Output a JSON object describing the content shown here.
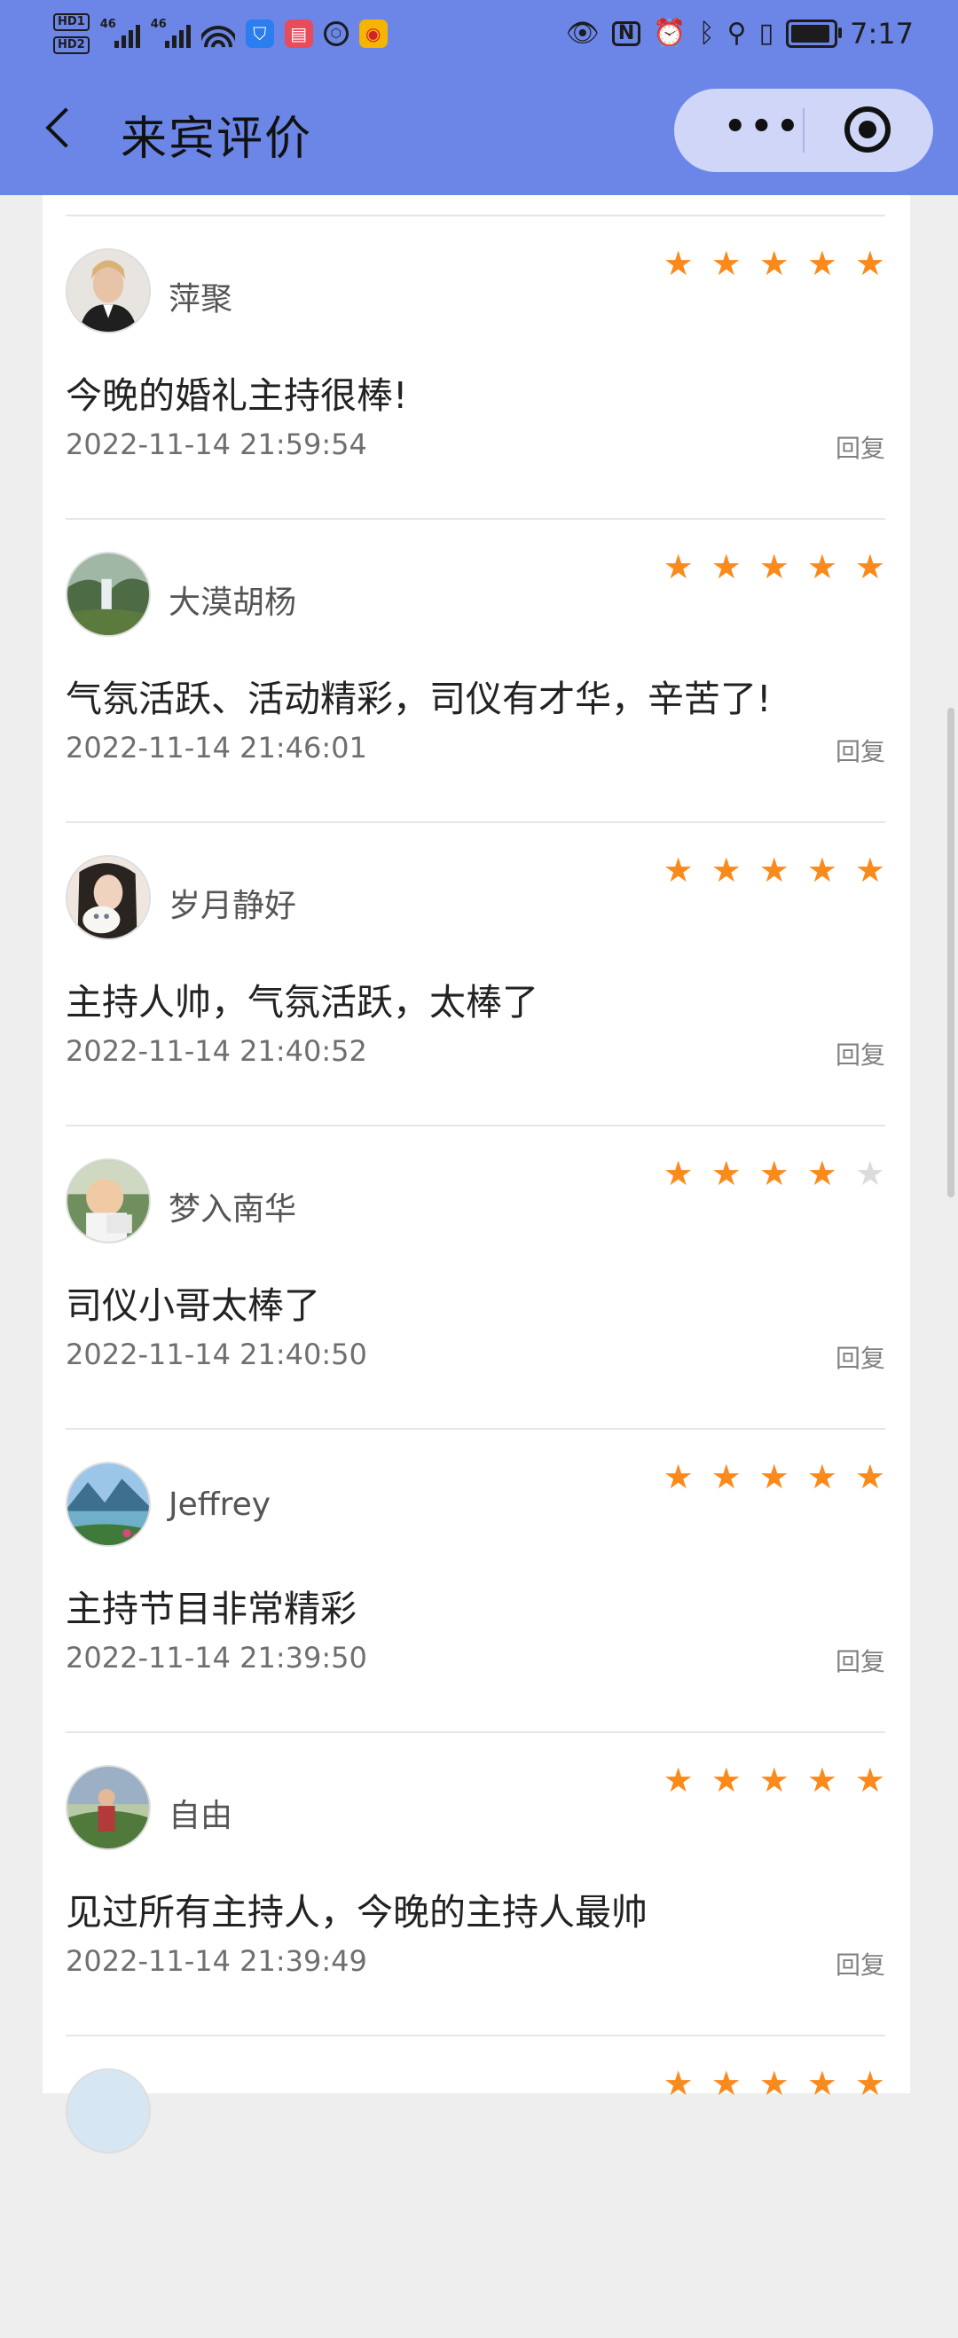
{
  "status_bar": {
    "hd_top": "HD1",
    "hd_bottom": "HD2",
    "network_1": "46",
    "network_2": "46",
    "nfc": "N",
    "time": "7:17"
  },
  "header": {
    "title": "来宾评价",
    "more_label": "•••",
    "background_color": "#6b86e6"
  },
  "reviews": [
    {
      "name": "萍聚",
      "comment": "今晚的婚礼主持很棒!",
      "time": "2022-11-14 21:59:54",
      "reply": "回复",
      "rating": 5
    },
    {
      "name": "大漠胡杨",
      "comment": "气氛活跃、活动精彩，司仪有才华，辛苦了!",
      "time": "2022-11-14 21:46:01",
      "reply": "回复",
      "rating": 5
    },
    {
      "name": "岁月静好",
      "comment": "主持人帅，气氛活跃，太棒了",
      "time": "2022-11-14 21:40:52",
      "reply": "回复",
      "rating": 5
    },
    {
      "name": "梦入南华",
      "comment": "司仪小哥太棒了",
      "time": "2022-11-14 21:40:50",
      "reply": "回复",
      "rating": 4
    },
    {
      "name": "Jeffrey",
      "comment": "主持节目非常精彩",
      "time": "2022-11-14 21:39:50",
      "reply": "回复",
      "rating": 5
    },
    {
      "name": "自由",
      "comment": "见过所有主持人，今晚的主持人最帅",
      "time": "2022-11-14 21:39:49",
      "reply": "回复",
      "rating": 5
    }
  ],
  "colors": {
    "star_filled": "#fb8a1c",
    "star_empty": "#dcdcdc"
  }
}
